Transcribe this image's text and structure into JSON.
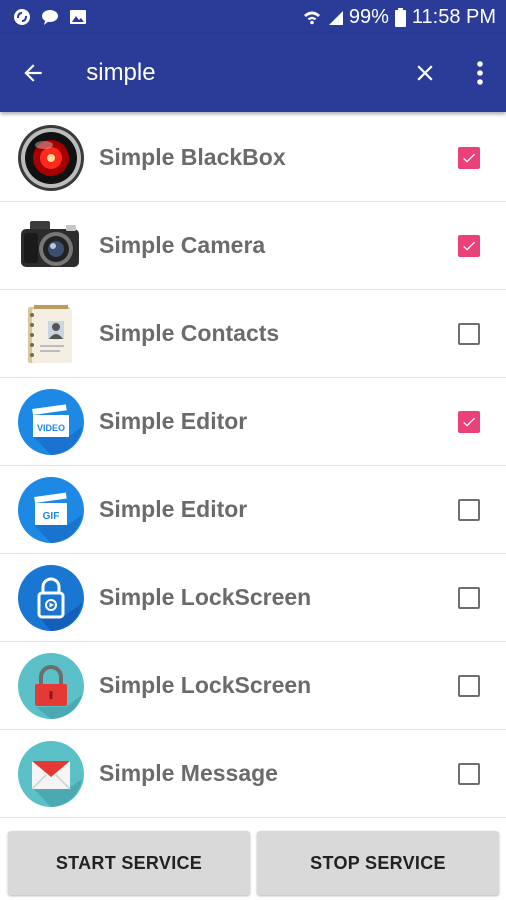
{
  "status_bar": {
    "battery": "99%",
    "time": "11:58 PM"
  },
  "app_bar": {
    "search_value": "simple",
    "icons": [
      "back-arrow-icon",
      "close-icon",
      "more-vert-icon"
    ]
  },
  "apps": [
    {
      "name": "Simple BlackBox",
      "checked": true,
      "icon": "red-eye-icon"
    },
    {
      "name": "Simple Camera",
      "checked": true,
      "icon": "camera-icon"
    },
    {
      "name": "Simple Contacts",
      "checked": false,
      "icon": "contacts-book-icon"
    },
    {
      "name": "Simple Editor",
      "checked": true,
      "icon": "video-clapper-icon",
      "badge": "VIDEO"
    },
    {
      "name": "Simple Editor",
      "checked": false,
      "icon": "gif-clapper-icon",
      "badge": "GIF"
    },
    {
      "name": "Simple LockScreen",
      "checked": false,
      "icon": "blue-lock-icon"
    },
    {
      "name": "Simple LockScreen",
      "checked": false,
      "icon": "red-lock-icon"
    },
    {
      "name": "Simple Message",
      "checked": false,
      "icon": "envelope-icon"
    }
  ],
  "buttons": {
    "start": "START SERVICE",
    "stop": "STOP SERVICE"
  },
  "colors": {
    "primary": "#2a3b98",
    "accent": "#ec407a"
  }
}
